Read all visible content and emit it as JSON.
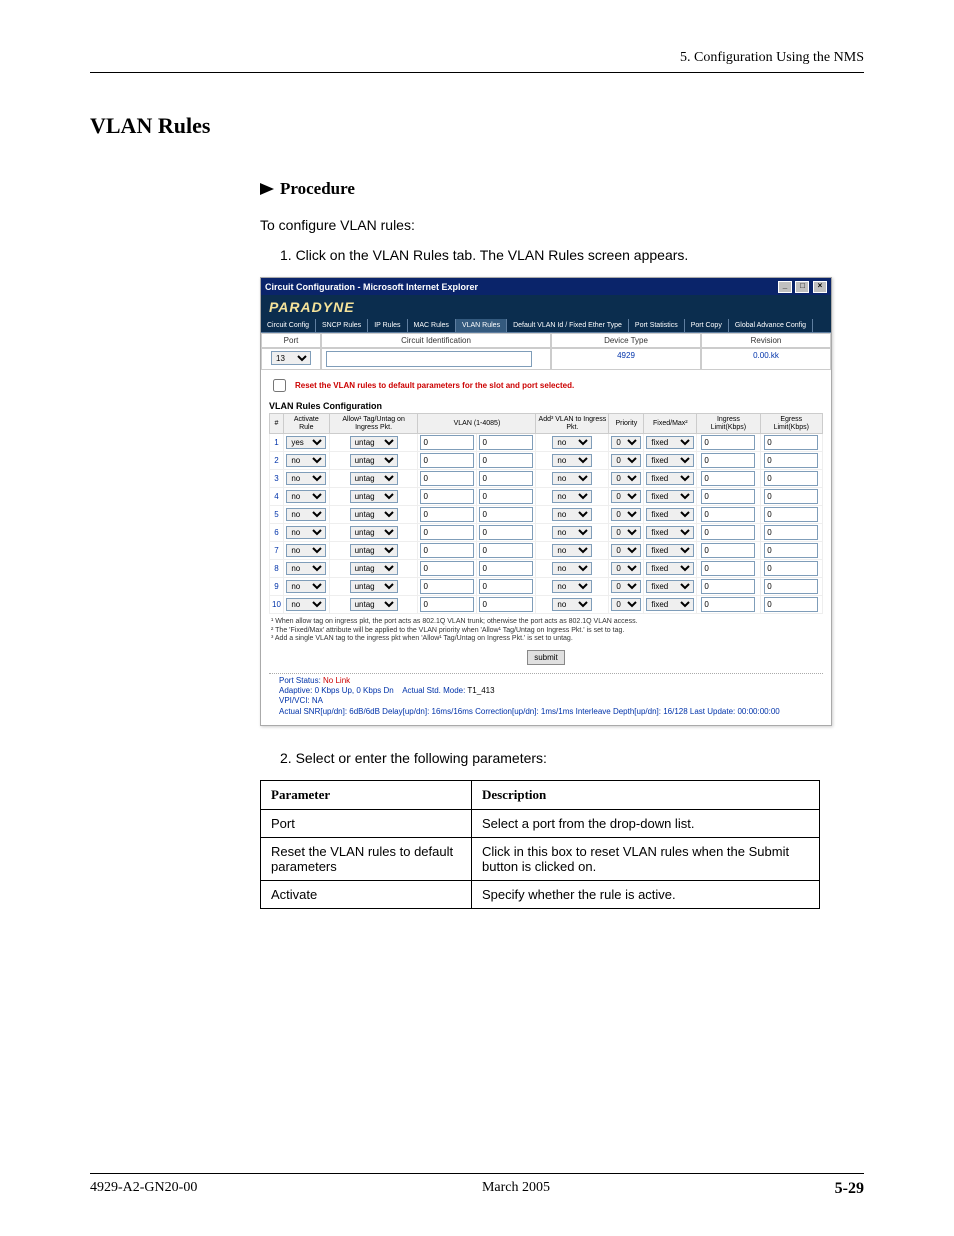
{
  "header": {
    "chapter": "5. Configuration Using the NMS"
  },
  "title": "VLAN Rules",
  "procedure": {
    "label": "Procedure",
    "intro": "To configure VLAN rules:",
    "step1": "1.  Click on the VLAN Rules tab. The VLAN Rules screen appears.",
    "step2": "2.  Select or enter the following parameters:"
  },
  "screenshot": {
    "window_title": "Circuit Configuration - Microsoft Internet Explorer",
    "brand": "PARADYNE",
    "tabs": [
      "Circuit Config",
      "SNCP Rules",
      "IP Rules",
      "MAC Rules",
      "VLAN Rules",
      "Default VLAN Id / Fixed Ether Type",
      "Port Statistics",
      "Port Copy",
      "Global Advance Config"
    ],
    "active_tab_index": 4,
    "info": {
      "headers": {
        "port": "Port",
        "circuit": "Circuit Identification",
        "device": "Device Type",
        "revision": "Revision"
      },
      "port_value": "13",
      "circuit_value": "",
      "device_value": "4929",
      "revision_value": "0.00.kk"
    },
    "reset_label": "Reset the VLAN rules to default parameters for the slot and port selected.",
    "vlan_rules_title": "VLAN Rules Configuration",
    "columns": {
      "num": "#",
      "activate": "Activate\nRule",
      "allow": "Allow¹\nTag/Untag\non Ingress Pkt.",
      "vlan": "VLAN\n(1-4085)",
      "add": "Add³\nVLAN to\nIngress Pkt.",
      "priority": "Priority",
      "fixedmax": "Fixed/Max²",
      "ingress": "Ingress\nLimit(Kbps)",
      "egress": "Egress\nLimit(Kbps)"
    },
    "rows": [
      {
        "n": 1,
        "activate": "yes",
        "allow": "untag",
        "vlan_a": "0",
        "vlan_b": "0",
        "add": "no",
        "priority": "0",
        "fixedmax": "fixed",
        "ingress": "0",
        "egress": "0"
      },
      {
        "n": 2,
        "activate": "no",
        "allow": "untag",
        "vlan_a": "0",
        "vlan_b": "0",
        "add": "no",
        "priority": "0",
        "fixedmax": "fixed",
        "ingress": "0",
        "egress": "0"
      },
      {
        "n": 3,
        "activate": "no",
        "allow": "untag",
        "vlan_a": "0",
        "vlan_b": "0",
        "add": "no",
        "priority": "0",
        "fixedmax": "fixed",
        "ingress": "0",
        "egress": "0"
      },
      {
        "n": 4,
        "activate": "no",
        "allow": "untag",
        "vlan_a": "0",
        "vlan_b": "0",
        "add": "no",
        "priority": "0",
        "fixedmax": "fixed",
        "ingress": "0",
        "egress": "0"
      },
      {
        "n": 5,
        "activate": "no",
        "allow": "untag",
        "vlan_a": "0",
        "vlan_b": "0",
        "add": "no",
        "priority": "0",
        "fixedmax": "fixed",
        "ingress": "0",
        "egress": "0"
      },
      {
        "n": 6,
        "activate": "no",
        "allow": "untag",
        "vlan_a": "0",
        "vlan_b": "0",
        "add": "no",
        "priority": "0",
        "fixedmax": "fixed",
        "ingress": "0",
        "egress": "0"
      },
      {
        "n": 7,
        "activate": "no",
        "allow": "untag",
        "vlan_a": "0",
        "vlan_b": "0",
        "add": "no",
        "priority": "0",
        "fixedmax": "fixed",
        "ingress": "0",
        "egress": "0"
      },
      {
        "n": 8,
        "activate": "no",
        "allow": "untag",
        "vlan_a": "0",
        "vlan_b": "0",
        "add": "no",
        "priority": "0",
        "fixedmax": "fixed",
        "ingress": "0",
        "egress": "0"
      },
      {
        "n": 9,
        "activate": "no",
        "allow": "untag",
        "vlan_a": "0",
        "vlan_b": "0",
        "add": "no",
        "priority": "0",
        "fixedmax": "fixed",
        "ingress": "0",
        "egress": "0"
      },
      {
        "n": 10,
        "activate": "no",
        "allow": "untag",
        "vlan_a": "0",
        "vlan_b": "0",
        "add": "no",
        "priority": "0",
        "fixedmax": "fixed",
        "ingress": "0",
        "egress": "0"
      }
    ],
    "footnotes": {
      "f1": "¹ When allow tag on ingress pkt, the port acts as 802.1Q VLAN trunk; otherwise the port acts as 802.1Q VLAN access.",
      "f2": "² The 'Fixed/Max' attribute will be applied to the VLAN priority when 'Allow¹ Tag/Untag on Ingress Pkt.' is set to tag.",
      "f3": "³ Add a single VLAN tag to the ingress pkt when 'Allow¹ Tag/Untag on Ingress Pkt.' is set to untag."
    },
    "submit_label": "submit",
    "status": {
      "port_status_label": "Port Status:",
      "port_status_value": "No Link",
      "adaptive": "Adaptive: 0 Kbps Up, 0 Kbps Dn",
      "std_mode_label": "Actual Std. Mode:",
      "std_mode_value": "T1_413",
      "vpivci": "VPI/VCI: NA",
      "line2": "Actual SNR[up/dn]: 6dB/6dB   Delay[up/dn]: 16ms/16ms   Correction[up/dn]: 1ms/1ms   Interleave Depth[up/dn]: 16/128  Last Update:  00:00:00:00"
    }
  },
  "param_table": {
    "headers": {
      "param": "Parameter",
      "desc": "Description"
    },
    "rows": [
      {
        "param": "Port",
        "desc": "Select a port from the drop-down list."
      },
      {
        "param": "Reset the VLAN rules to default parameters",
        "desc": "Click in this box to reset VLAN rules when the Submit button is clicked on."
      },
      {
        "param": "Activate",
        "desc": "Specify whether the rule is active."
      }
    ]
  },
  "footer": {
    "left": "4929-A2-GN20-00",
    "center": "March 2005",
    "right": "5-29"
  }
}
